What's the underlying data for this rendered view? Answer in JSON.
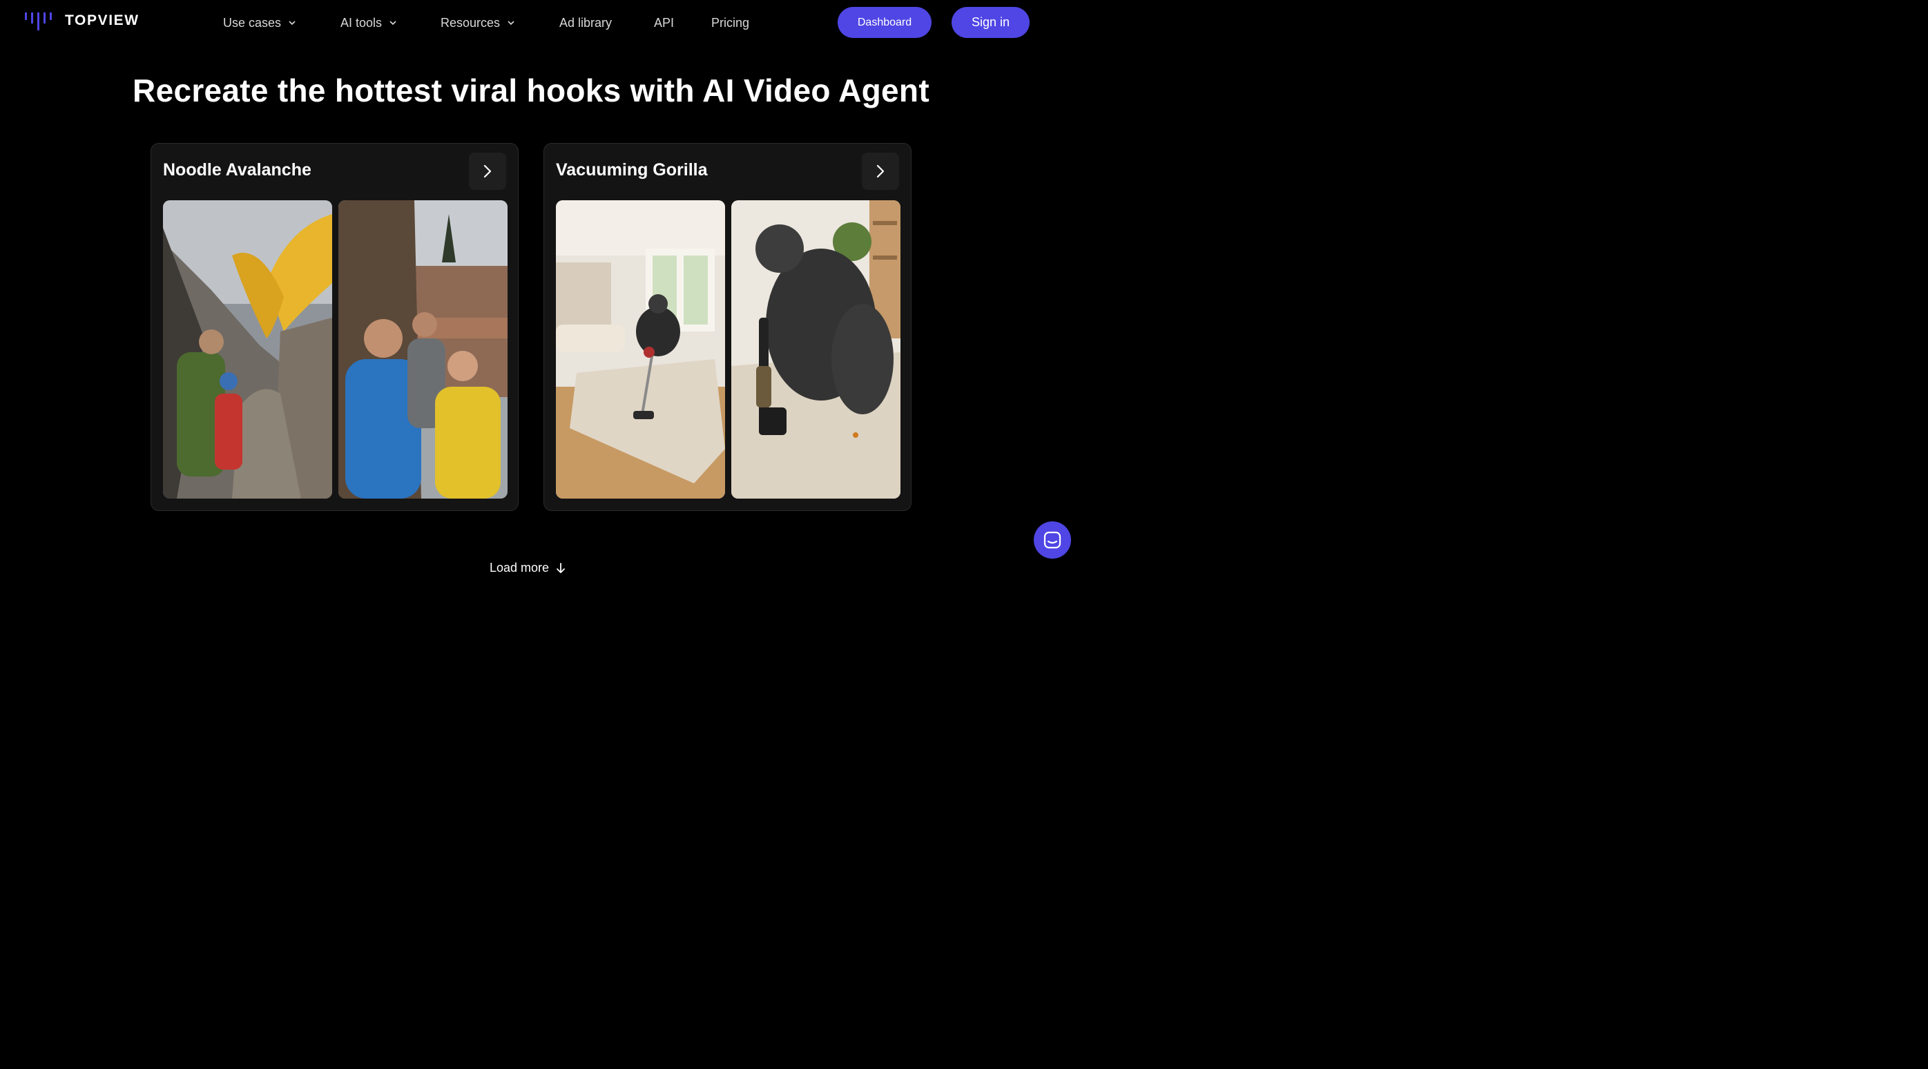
{
  "brand": {
    "name": "TOPVIEW",
    "accent": "#4f46e5"
  },
  "nav": {
    "items": [
      {
        "label": "Use cases",
        "has_dropdown": true
      },
      {
        "label": "AI tools",
        "has_dropdown": true
      },
      {
        "label": "Resources",
        "has_dropdown": true
      },
      {
        "label": "Ad library",
        "has_dropdown": false
      },
      {
        "label": "API",
        "has_dropdown": false
      },
      {
        "label": "Pricing",
        "has_dropdown": false
      }
    ]
  },
  "header": {
    "dashboard_label": "Dashboard",
    "signin_label": "Sign in"
  },
  "hero": {
    "title": "Recreate the hottest viral hooks with AI Video Agent"
  },
  "cards": [
    {
      "title": "Noodle Avalanche",
      "icon": "chevron-right-icon",
      "thumbnails": [
        "hikers-noodle-avalanche-thumbnail",
        "hikers-cliff-edge-thumbnail"
      ]
    },
    {
      "title": "Vacuuming Gorilla",
      "icon": "chevron-right-icon",
      "thumbnails": [
        "gorilla-living-room-thumbnail",
        "gorilla-vacuum-closeup-thumbnail"
      ]
    }
  ],
  "load_more": {
    "label": "Load more",
    "icon": "arrow-down-icon"
  },
  "chat": {
    "icon": "chat-icon"
  }
}
